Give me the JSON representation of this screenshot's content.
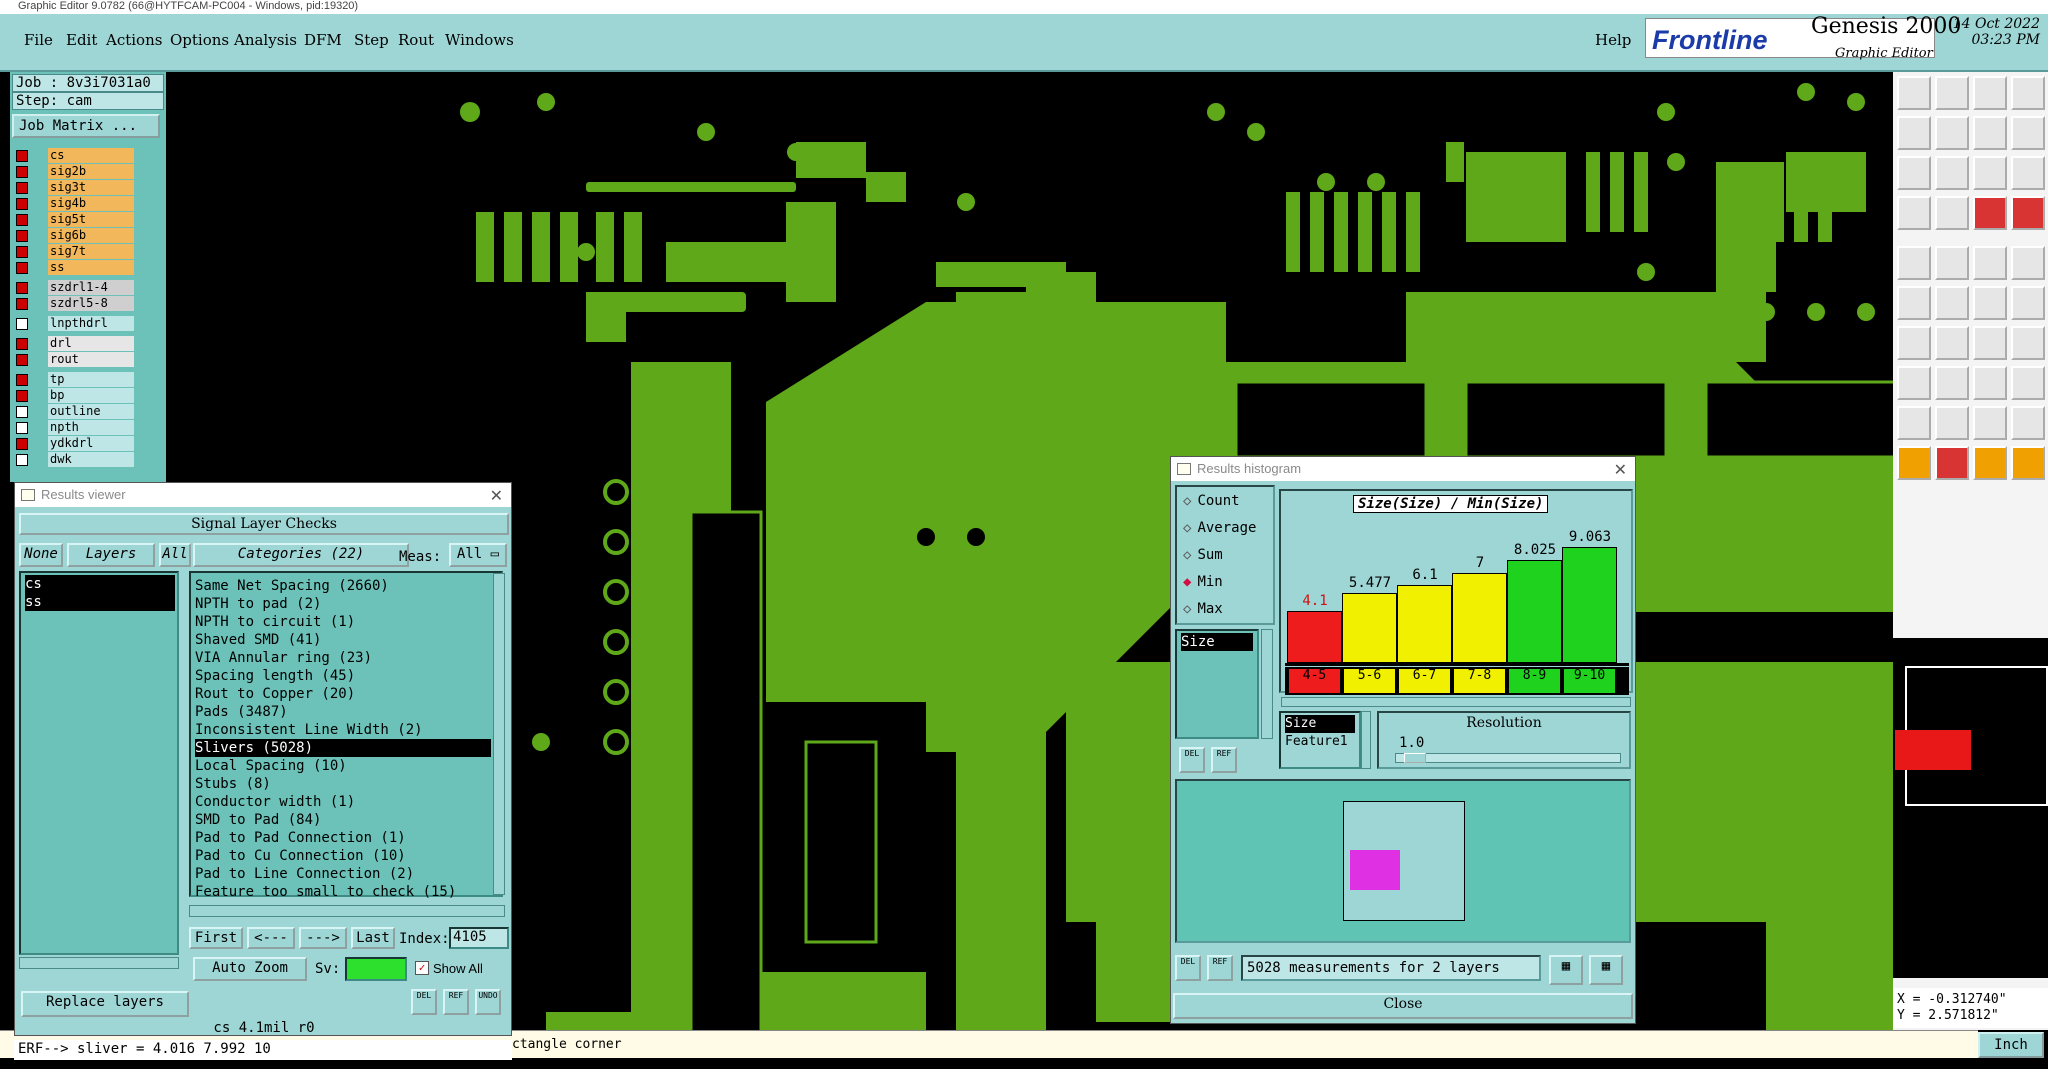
{
  "window_title": "Graphic Editor 9.0782 (66@HYTFCAM-PC004 - Windows, pid:19320)",
  "menu": {
    "items": [
      "File",
      "Edit",
      "Actions",
      "Options",
      "Analysis",
      "DFM",
      "Step",
      "Rout",
      "Windows"
    ],
    "help": "Help"
  },
  "brand": {
    "logo": "Frontline",
    "product": "Genesis 2000",
    "subtitle": "Graphic Editor",
    "date": "14 Oct 2022",
    "time": "03:23 PM"
  },
  "job": {
    "job": "Job : 8v3i7031a0",
    "step": "Step: cam",
    "matrix_button": "Job Matrix ..."
  },
  "layers": [
    {
      "name": "cs",
      "color": "orange",
      "checked": true
    },
    {
      "name": "sig2b",
      "color": "orange",
      "checked": true
    },
    {
      "name": "sig3t",
      "color": "orange",
      "checked": true
    },
    {
      "name": "sig4b",
      "color": "orange",
      "checked": true
    },
    {
      "name": "sig5t",
      "color": "orange",
      "checked": true
    },
    {
      "name": "sig6b",
      "color": "orange",
      "checked": true
    },
    {
      "name": "sig7t",
      "color": "orange",
      "checked": true
    },
    {
      "name": "ss",
      "color": "orange",
      "checked": true
    },
    {
      "name": "szdrl1-4",
      "color": "gray",
      "checked": true
    },
    {
      "name": "szdrl5-8",
      "color": "gray",
      "checked": true
    },
    {
      "name": "lnpthdrl",
      "color": "cyan",
      "checked": false
    },
    {
      "name": "drl",
      "color": "white",
      "checked": true
    },
    {
      "name": "rout",
      "color": "white",
      "checked": true
    },
    {
      "name": "tp",
      "color": "cyan",
      "checked": true
    },
    {
      "name": "bp",
      "color": "cyan",
      "checked": true
    },
    {
      "name": "outline",
      "color": "cyan",
      "checked": false
    },
    {
      "name": "npth",
      "color": "cyan",
      "checked": false
    },
    {
      "name": "ydkdrl",
      "color": "cyan",
      "checked": true
    },
    {
      "name": "dwk",
      "color": "cyan",
      "checked": false
    }
  ],
  "results_viewer": {
    "title": "Results viewer",
    "header": "Signal Layer Checks",
    "none_label": "None",
    "layers_label": "Layers",
    "all_label": "All",
    "categories_label": "Categories (22)",
    "meas_label": "Meas:",
    "meas_value": "All",
    "layers": [
      "cs",
      "ss"
    ],
    "categories": [
      "Same Net Spacing (2660)",
      "NPTH to pad (2)",
      "NPTH to circuit (1)",
      "Shaved SMD (41)",
      "VIA Annular ring (23)",
      "Spacing length (45)",
      "Rout to Copper (20)",
      "Pads (3487)",
      "Inconsistent Line Width (2)",
      "Slivers (5028)",
      "Local Spacing (10)",
      "Stubs (8)",
      "Conductor width (1)",
      "SMD to Pad (84)",
      "Pad to Pad Connection (1)",
      "Pad to Cu Connection (10)",
      "Pad to Line Connection (2)",
      "Feature too small to check (15)"
    ],
    "selected_category": "Slivers (5028)",
    "nav": {
      "first": "First",
      "prev": "<---",
      "next": "--->",
      "last": "Last",
      "index_label": "Index:",
      "index_value": "4105"
    },
    "auto_zoom": "Auto Zoom",
    "sv_label": "Sv:",
    "show_all": "Show All",
    "replace_layers": "Replace layers",
    "icon_labels": [
      "DEL",
      "REF",
      "UNDO"
    ],
    "status": "cs 4.1mil  r0"
  },
  "histogram": {
    "title": "Results histogram",
    "modes": [
      "Count",
      "Average",
      "Sum",
      "Min",
      "Max"
    ],
    "selected_mode": "Min",
    "measure_list": [
      "Size"
    ],
    "chart_title": "Size(Size) / Min(Size)",
    "attr_list": [
      "Size",
      "Feature1"
    ],
    "resolution_label": "Resolution",
    "resolution_value": "1.0",
    "summary": "5028 measurements for 2 layers",
    "close": "Close",
    "icon_labels": [
      "DEL",
      "REF"
    ]
  },
  "chart_data": {
    "type": "bar",
    "title": "Size(Size) / Min(Size)",
    "categories": [
      "4-5",
      "5-6",
      "6-7",
      "7-8",
      "8-9",
      "9-10"
    ],
    "values": [
      4.1,
      5.477,
      6.1,
      7,
      8.025,
      9.063
    ],
    "value_labels": [
      "4.1",
      "5.477",
      "6.1",
      "7",
      "8.025",
      "9.063"
    ],
    "colors": [
      "#ee1c1c",
      "#f0f000",
      "#f0f000",
      "#f0f000",
      "#1ed21e",
      "#1ed21e"
    ]
  },
  "coords": {
    "x": "X = -0.312740\"",
    "y": "Y = 2.571812\""
  },
  "units": "Inch",
  "status_line": "ctangle corner",
  "erf_line": "ERF--> sliver = 4.016 7.992 10"
}
